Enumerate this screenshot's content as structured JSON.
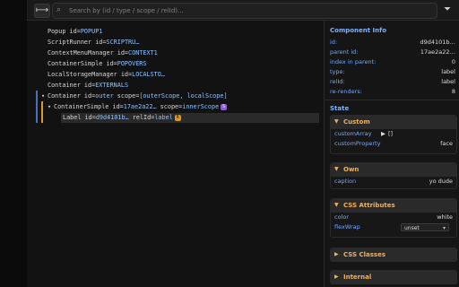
{
  "topbar": {
    "search_placeholder": "Search by (id / type / scope / relId)...",
    "pick_icon": "component-picker-icon",
    "filter_icon": "filter-icon"
  },
  "tree": {
    "rows": [
      {
        "text": "Popup id=",
        "val": "POPUP1"
      },
      {
        "text": "ScriptRunner id=",
        "val": "SCRIPTRU…"
      },
      {
        "text": "ContextMenuManager id=",
        "val": "CONTEXT1"
      },
      {
        "text": "ContainerSimple id=",
        "val": "POPOVERS"
      },
      {
        "text": "LocalStorageManager id=",
        "val": "LOCALSTO…"
      },
      {
        "text": "Container id=",
        "val": "EXTERNALS"
      },
      {
        "text": "Container id=",
        "val": "outer",
        "extra": " scope=",
        "extraval": "[outerScope, localScope]"
      },
      {
        "text": "ContainerSimple id=",
        "val": "17ae2a22…",
        "extra": " scope=",
        "extraval": "innerScope",
        "badge": "S"
      },
      {
        "text": "Label id=",
        "val": "d9d4101b…",
        "extra": " relId=",
        "extraval": "label",
        "badge": "R"
      }
    ]
  },
  "component_info": {
    "title": "Component Info",
    "rows": [
      {
        "k": "id:",
        "v": "d9d4101b…"
      },
      {
        "k": "parent id:",
        "v": "17ae2a22…"
      },
      {
        "k": "index in parent:",
        "v": "0"
      },
      {
        "k": "type:",
        "v": "label"
      },
      {
        "k": "relId:",
        "v": "label"
      },
      {
        "k": "re-renders:",
        "v": "8"
      }
    ]
  },
  "state": {
    "title": "State",
    "custom": {
      "title": "Custom",
      "rows": [
        {
          "k": "customArray",
          "v": "[]"
        },
        {
          "k": "customProperty",
          "v": "face"
        }
      ]
    },
    "own": {
      "title": "Own",
      "rows": [
        {
          "k": "caption",
          "v": "yo dude"
        }
      ]
    },
    "css_attributes": {
      "title": "CSS Attributes",
      "rows": [
        {
          "k": "color",
          "v": "white"
        },
        {
          "k": "flexWrap",
          "v": "unset"
        }
      ]
    },
    "css_classes": {
      "title": "CSS Classes"
    },
    "internal": {
      "title": "Internal"
    }
  },
  "colors": {
    "accent_blue": "#74a7ff",
    "accent_orange": "#f0b15a",
    "badge_purple": "#8e5bd6",
    "badge_orange": "#d79a2a"
  }
}
